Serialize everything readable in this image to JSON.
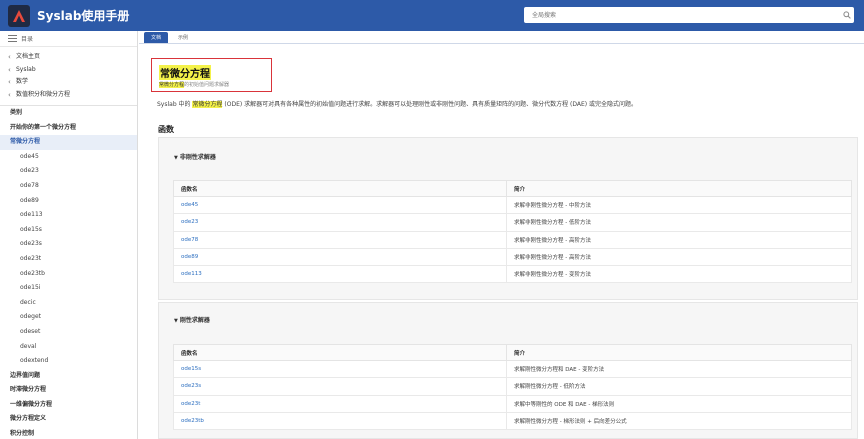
{
  "app": {
    "title": "Syslab使用手册"
  },
  "search": {
    "placeholder": "全局搜索"
  },
  "sidebar": {
    "header": "目录",
    "breadcrumbs": [
      "文档主页",
      "Syslab",
      "数学",
      "数值积分和微分方程"
    ],
    "items": [
      {
        "label": "类别",
        "level": 0
      },
      {
        "label": "开始你的第一个微分方程",
        "level": 0
      },
      {
        "label": "常微分方程",
        "level": 0,
        "active": true
      },
      {
        "label": "ode45",
        "level": 1
      },
      {
        "label": "ode23",
        "level": 1
      },
      {
        "label": "ode78",
        "level": 1
      },
      {
        "label": "ode89",
        "level": 1
      },
      {
        "label": "ode113",
        "level": 1
      },
      {
        "label": "ode15s",
        "level": 1
      },
      {
        "label": "ode23s",
        "level": 1
      },
      {
        "label": "ode23t",
        "level": 1
      },
      {
        "label": "ode23tb",
        "level": 1
      },
      {
        "label": "ode15i",
        "level": 1
      },
      {
        "label": "decic",
        "level": 1
      },
      {
        "label": "odeget",
        "level": 1
      },
      {
        "label": "odeset",
        "level": 1
      },
      {
        "label": "deval",
        "level": 1
      },
      {
        "label": "odextend",
        "level": 1
      },
      {
        "label": "边界值问题",
        "level": 0
      },
      {
        "label": "时滞微分方程",
        "level": 0
      },
      {
        "label": "一维偏微分方程",
        "level": 0
      },
      {
        "label": "微分方程定义",
        "level": 0
      },
      {
        "label": "积分控制",
        "level": 0
      }
    ]
  },
  "tabs": [
    "文档",
    "示例"
  ],
  "page": {
    "title": "常微分方程",
    "subtitle_hl": "常微分方程",
    "subtitle_rest": "的初始值问题求解器",
    "intro_pre": "Syslab 中的",
    "intro_hl": "常微分方程",
    "intro_post": " (ODE) 求解器可对具有各种属性的初始值问题进行求解。求解器可以处理刚性或非刚性问题、具有质量矩阵的问题、微分代数方程 (DAE) 或完全隐式问题。",
    "section": "函数"
  },
  "panels": [
    {
      "title": "非刚性求解器",
      "headers": [
        "函数名",
        "简介"
      ],
      "rows": [
        [
          "ode45",
          "求解非刚性微分方程 - 中阶方法"
        ],
        [
          "ode23",
          "求解非刚性微分方程 - 低阶方法"
        ],
        [
          "ode78",
          "求解非刚性微分方程 - 高阶方法"
        ],
        [
          "ode89",
          "求解非刚性微分方程 - 高阶方法"
        ],
        [
          "ode113",
          "求解非刚性微分方程 - 变阶方法"
        ]
      ]
    },
    {
      "title": "刚性求解器",
      "headers": [
        "函数名",
        "简介"
      ],
      "rows": [
        [
          "ode15s",
          "求解刚性微分方程和 DAE - 变阶方法"
        ],
        [
          "ode23s",
          "求解刚性微分方程 - 低阶方法"
        ],
        [
          "ode23t",
          "求解中等刚性的 ODE 和 DAE - 梯形法则"
        ],
        [
          "ode23tb",
          "求解刚性微分方程 - 梯形法则 + 后向差分公式"
        ]
      ]
    }
  ]
}
